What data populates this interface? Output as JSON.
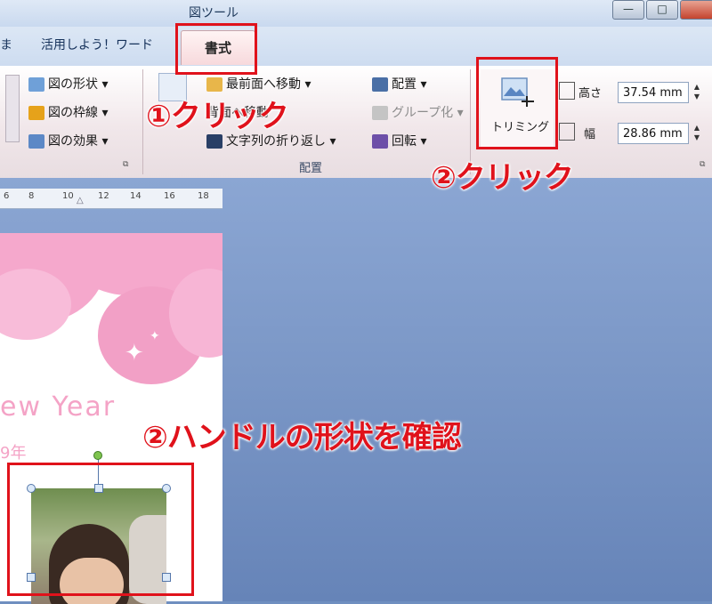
{
  "window": {
    "context_title": "図ツール",
    "buttons": [
      "—",
      "□"
    ]
  },
  "tabs": {
    "partial_left": "ま",
    "katsuyo": "活用しよう！ワード",
    "active": "書式"
  },
  "ribbon": {
    "left_group": {
      "items": [
        "図の形状",
        "図の枠線",
        "図の効果"
      ]
    },
    "arrange_group": {
      "label": "配置",
      "items": {
        "bring_front": "最前面へ移動",
        "send_back": "背面へ移動",
        "wrap_text": "文字列の折り返し",
        "position": "配置",
        "group": "グループ化",
        "rotate": "回転"
      }
    },
    "size_group": {
      "trim_label": "トリミング",
      "height_label": "高さ",
      "height_value": "37.54 mm",
      "width_label": "幅",
      "width_value": "28.86 mm"
    }
  },
  "ruler": {
    "ticks": [
      "6",
      "8",
      "10",
      "12",
      "14",
      "16",
      "18"
    ]
  },
  "document": {
    "greeting": "ew Year",
    "year": "9年"
  },
  "annotations": {
    "step1": "①クリック",
    "step2": "②クリック",
    "step3": "②ハンドルの形状を確認"
  },
  "colors": {
    "annotation_red": "#e0121b",
    "active_tab_pink": "#f7d9dc",
    "card_pink": "#f5a8cc"
  }
}
